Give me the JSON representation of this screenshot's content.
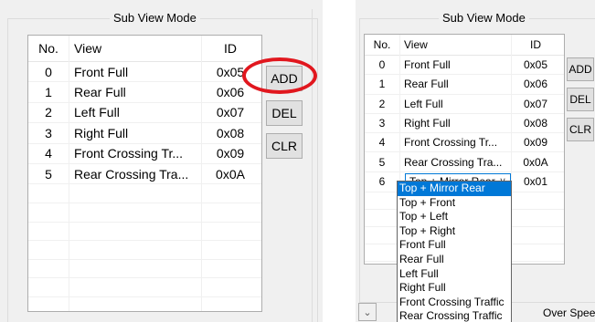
{
  "left": {
    "group_title": "Sub View Mode",
    "headers": {
      "no": "No.",
      "view": "View",
      "id": "ID"
    },
    "rows": [
      {
        "no": "0",
        "view": "Front Full",
        "id": "0x05"
      },
      {
        "no": "1",
        "view": "Rear Full",
        "id": "0x06"
      },
      {
        "no": "2",
        "view": "Left Full",
        "id": "0x07"
      },
      {
        "no": "3",
        "view": "Right Full",
        "id": "0x08"
      },
      {
        "no": "4",
        "view": "Front Crossing Tr...",
        "id": "0x09"
      },
      {
        "no": "5",
        "view": "Rear Crossing Tra...",
        "id": "0x0A"
      }
    ],
    "buttons": {
      "add": "ADD",
      "del": "DEL",
      "clr": "CLR"
    }
  },
  "right": {
    "group_title": "Sub View Mode",
    "headers": {
      "no": "No.",
      "view": "View",
      "id": "ID"
    },
    "rows": [
      {
        "no": "0",
        "view": "Front Full",
        "id": "0x05"
      },
      {
        "no": "1",
        "view": "Rear Full",
        "id": "0x06"
      },
      {
        "no": "2",
        "view": "Left Full",
        "id": "0x07"
      },
      {
        "no": "3",
        "view": "Right Full",
        "id": "0x08"
      },
      {
        "no": "4",
        "view": "Front Crossing Tr...",
        "id": "0x09"
      },
      {
        "no": "5",
        "view": "Rear Crossing Tra...",
        "id": "0x0A"
      },
      {
        "no": "6",
        "view": "Top + Mirror Rear",
        "id": "0x01"
      }
    ],
    "combo_value": "Top + Mirror Rear",
    "dropdown_items": [
      "Top + Mirror Rear",
      "Top + Front",
      "Top + Left",
      "Top + Right",
      "Front Full",
      "Rear Full",
      "Left Full",
      "Right Full",
      "Front Crossing Traffic",
      "Rear Crossing Traffic"
    ],
    "selected_dropdown_item": "Top + Mirror Rear",
    "buttons": {
      "add": "ADD",
      "del": "DEL",
      "clr": "CLR"
    },
    "bottom_label": "Over Spee"
  },
  "colors": {
    "highlight": "#0078d7",
    "annotation_red": "#e1171e",
    "panel_bg": "#f0f0f0"
  }
}
